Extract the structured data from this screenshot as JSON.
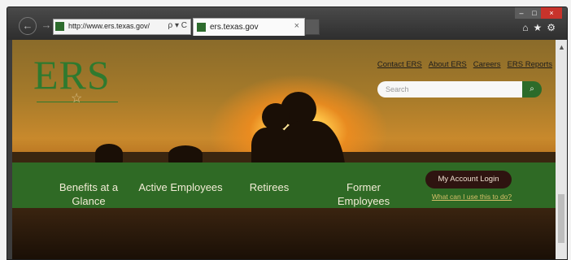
{
  "browser": {
    "address_url": "http://www.ers.texas.gov/",
    "address_tools": "ρ ▾ C",
    "tab_title": "ers.texas.gov",
    "tab_close": "×",
    "back_glyph": "←",
    "forward_glyph": "→",
    "window_controls": {
      "minimize": "–",
      "maximize": "□",
      "close": "×"
    },
    "right_tools": "⌂★⚙"
  },
  "site": {
    "logo_text": "ERS",
    "top_links": [
      "Contact ERS",
      "About ERS",
      "Careers",
      "ERS Reports"
    ],
    "search_placeholder": "Search",
    "search_icon": "search-icon",
    "nav": {
      "benefits": "Benefits at a Glance",
      "active": "Active Employees",
      "retirees": "Retirees",
      "former": "Former Employees"
    },
    "account_button": "My Account Login",
    "account_help": "What can I use this to do?"
  },
  "colors": {
    "brand_green": "#2f6a25",
    "account_button": "#2e1410"
  }
}
